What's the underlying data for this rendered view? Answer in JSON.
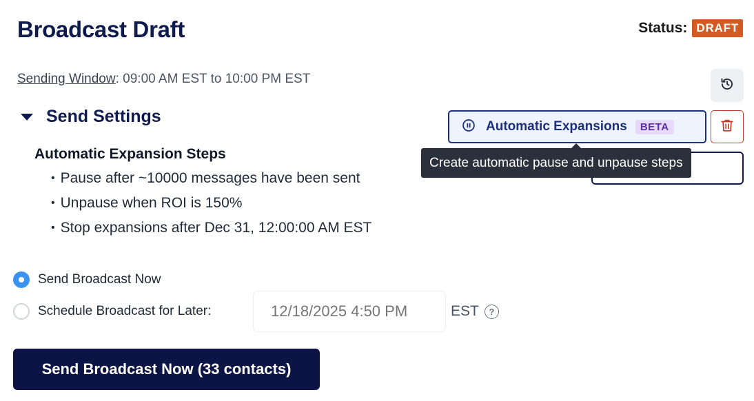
{
  "header": {
    "title": "Broadcast Draft",
    "status_label": "Status:",
    "status_value": "DRAFT"
  },
  "sending_window": {
    "label": "Sending Window",
    "value": ": 09:00 AM EST to 10:00 PM EST"
  },
  "settings": {
    "title": "Send Settings",
    "auto_button_label": "Automatic Expansions",
    "auto_button_badge": "BETA",
    "tooltip": "Create automatic pause and unpause steps",
    "steps_heading": "Automatic Expansion Steps",
    "steps": [
      "Pause after ~10000 messages have been sent",
      "Unpause when ROI is 150%",
      "Stop expansions after Dec 31, 12:00:00 AM EST"
    ]
  },
  "send_options": {
    "now_label": "Send Broadcast Now",
    "later_label": "Schedule Broadcast for Later:",
    "selected": "now",
    "date_placeholder": "12/18/2025 4:50 PM",
    "timezone": "EST",
    "help_glyph": "?"
  },
  "send_button": {
    "label": "Send Broadcast Now (33 contacts)"
  },
  "colors": {
    "brand_navy": "#0f1b4d",
    "draft_badge": "#d45a23",
    "radio_selected": "#3b93f0",
    "delete_red": "#c0392b",
    "beta_bg": "#e7d9fb"
  },
  "icons": [
    "history-icon",
    "pause-circle-icon",
    "trash-icon",
    "caret-down-icon",
    "help-circle-icon"
  ]
}
